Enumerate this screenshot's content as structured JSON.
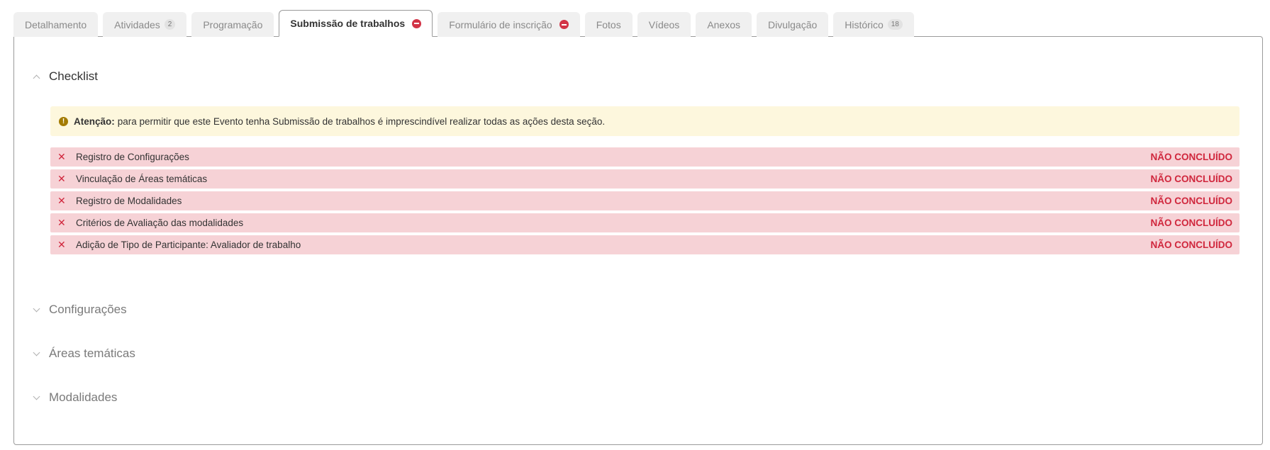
{
  "tabs": [
    {
      "label": "Detalhamento"
    },
    {
      "label": "Atividades",
      "count": "2"
    },
    {
      "label": "Programação"
    },
    {
      "label": "Submissão de trabalhos",
      "active": true,
      "status_icon": "minus-circle-icon"
    },
    {
      "label": "Formulário de inscrição",
      "status_icon": "minus-circle-icon"
    },
    {
      "label": "Fotos"
    },
    {
      "label": "Vídeos"
    },
    {
      "label": "Anexos"
    },
    {
      "label": "Divulgação"
    },
    {
      "label": "Histórico",
      "count": "18"
    }
  ],
  "checklist": {
    "title": "Checklist",
    "alert": {
      "icon": "exclamation-circle-icon",
      "strong": "Atenção:",
      "text": "para permitir que este Evento tenha Submissão de trabalhos é imprescindível realizar todas as ações desta seção."
    },
    "items": [
      {
        "label": "Registro de Configurações",
        "status": "NÃO CONCLUÍDO"
      },
      {
        "label": "Vinculação de Áreas temáticas",
        "status": "NÃO CONCLUÍDO"
      },
      {
        "label": "Registro de Modalidades",
        "status": "NÃO CONCLUÍDO"
      },
      {
        "label": "Critérios de Avaliação das modalidades",
        "status": "NÃO CONCLUÍDO"
      },
      {
        "label": "Adição de Tipo de Participante: Avaliador de trabalho",
        "status": "NÃO CONCLUÍDO"
      }
    ]
  },
  "sections": [
    {
      "title": "Configurações"
    },
    {
      "title": "Áreas temáticas"
    },
    {
      "title": "Modalidades"
    }
  ],
  "colors": {
    "error": "#d0273d",
    "error_bg": "#f6d2d6",
    "warning_bg": "#fdf7dd",
    "warning_icon": "#a37b00",
    "tab_bg": "#f0f0f0"
  }
}
